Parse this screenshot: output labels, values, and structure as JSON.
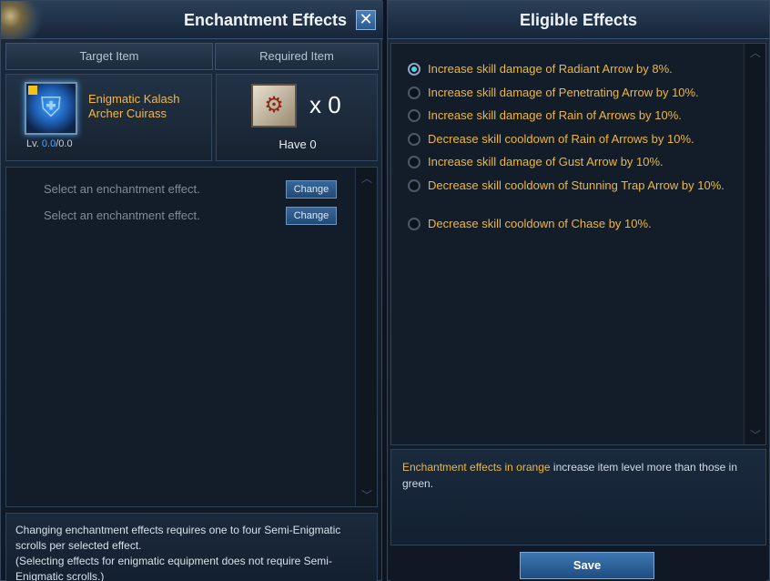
{
  "left_panel": {
    "title": "Enchantment Effects",
    "close_glyph": "✕",
    "columns": {
      "target": "Target Item",
      "required": "Required Item"
    },
    "target_item": {
      "name": "Enigmatic Kalash Archer Cuirass",
      "level_prefix": "Lv.",
      "level_current": "0.0",
      "level_max": "/0.0",
      "icon": "armor-icon",
      "rarity_color": "#efb640"
    },
    "required_item": {
      "icon": "scroll-icon",
      "count": "x 0",
      "have": "Have 0"
    },
    "slots": [
      {
        "text": "Select an enchantment effect.",
        "button": "Change"
      },
      {
        "text": "Select an enchantment effect.",
        "button": "Change"
      }
    ],
    "notice": "Changing enchantment effects requires one to four Semi-Enigmatic scrolls per selected effect.",
    "notice2": "(Selecting effects for enigmatic equipment does not require Semi-Enigmatic scrolls.)"
  },
  "right_panel": {
    "title": "Eligible Effects",
    "effects": [
      {
        "text": "Increase skill damage of Radiant Arrow by 8%.",
        "selected": true
      },
      {
        "text": "Increase skill damage of Penetrating Arrow by 10%.",
        "selected": false
      },
      {
        "text": "Increase skill damage of Rain of Arrows by 10%.",
        "selected": false
      },
      {
        "text": "Decrease skill cooldown of Rain of Arrows by 10%.",
        "selected": false
      },
      {
        "text": "Increase skill damage of Gust Arrow by 10%.",
        "selected": false
      },
      {
        "text": "Decrease skill cooldown of Stunning Trap Arrow by 10%.",
        "selected": false
      },
      {
        "text": "Decrease skill cooldown of Chase by 10%.",
        "selected": false
      }
    ],
    "info": {
      "highlight": "Enchantment effects in orange",
      "rest": " increase item level more than those in green."
    },
    "save_label": "Save"
  },
  "colors": {
    "accent": "#efb640",
    "level_blue": "#4fa3ff",
    "button_blue": "#2b5a93"
  }
}
